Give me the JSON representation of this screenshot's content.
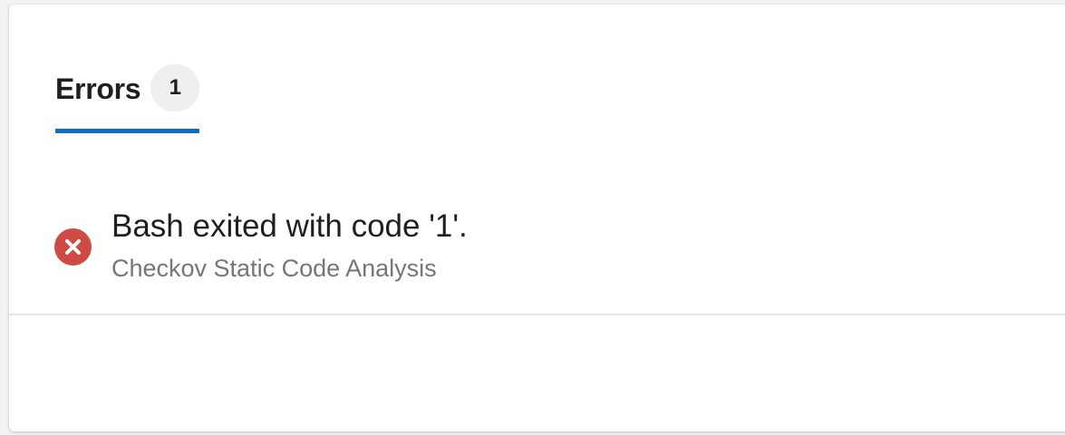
{
  "tabs": {
    "errors": {
      "label": "Errors",
      "count": "1"
    }
  },
  "errors": [
    {
      "title": "Bash exited with code '1'.",
      "source": "Checkov Static Code Analysis",
      "icon": "error-circle-icon",
      "icon_color": "#cd4a45"
    }
  ],
  "colors": {
    "accent": "#0f6cbd",
    "error": "#cd4a45"
  }
}
